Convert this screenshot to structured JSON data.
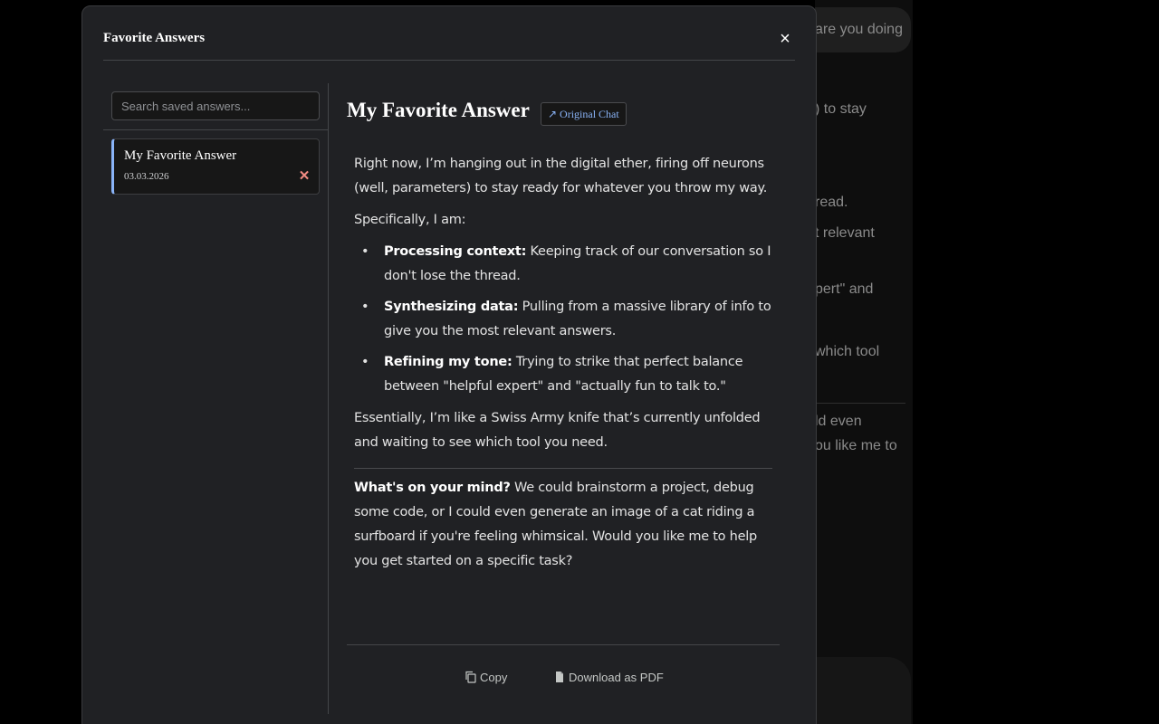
{
  "background_chat": {
    "lines": [
      "are you doing",
      ") to stay",
      "read.",
      "t relevant",
      "pert\" and",
      "which tool",
      "ld even",
      "ou like me to"
    ]
  },
  "modal": {
    "title": "Favorite Answers",
    "close_label": "×"
  },
  "sidebar": {
    "search_placeholder": "Search saved answers...",
    "items": [
      {
        "title": "My Favorite Answer",
        "date": "03.03.2026",
        "delete_label": "✕"
      }
    ]
  },
  "answer": {
    "title": "My Favorite Answer",
    "original_chat_label": "↗ Original Chat",
    "intro": "Right now, I’m hanging out in the digital ether, firing off neurons (well, parameters) to stay ready for whatever you throw my way.",
    "lead_in": "Specifically, I am:",
    "bullets": [
      {
        "bold": "Processing context:",
        "text": " Keeping track of our conversation so I don't lose the thread."
      },
      {
        "bold": "Synthesizing data:",
        "text": " Pulling from a massive library of info to give you the most relevant answers."
      },
      {
        "bold": "Refining my tone:",
        "text": " Trying to strike that perfect balance between \"helpful expert\" and \"actually fun to talk to.\""
      }
    ],
    "summary": "Essentially, I’m like a Swiss Army knife that’s currently unfolded and waiting to see which tool you need.",
    "closing_bold": "What's on your mind?",
    "closing_text": " We could brainstorm a project, debug some code, or I could even generate an image of a cat riding a surfboard if you're feeling whimsical. Would you like me to help you get started on a specific task?"
  },
  "footer": {
    "copy_label": "Copy",
    "pdf_label": "Download as PDF"
  },
  "colors": {
    "accent": "#8ab4f8",
    "danger": "#f28b82",
    "modal_bg": "#202124"
  }
}
